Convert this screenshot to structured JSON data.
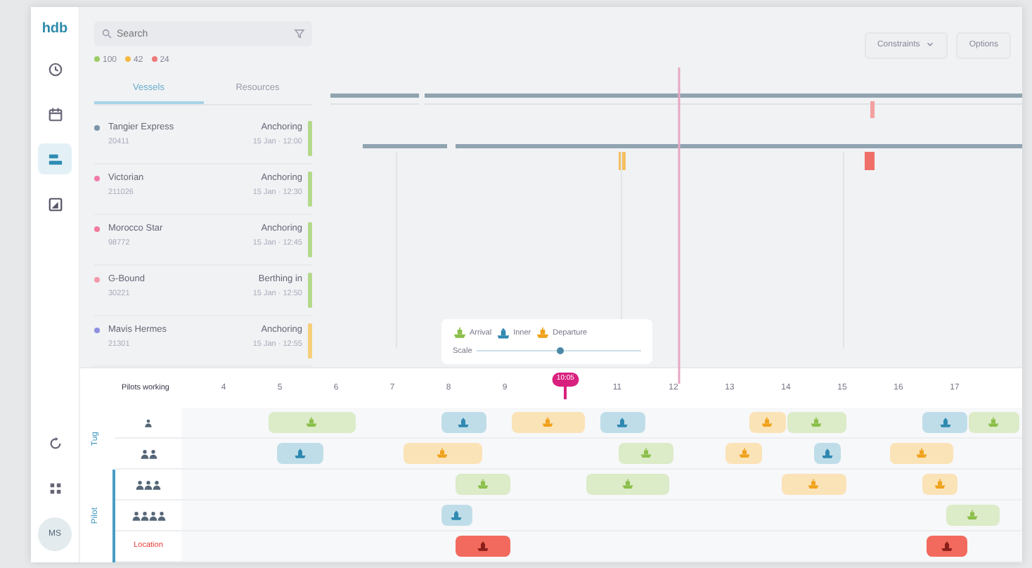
{
  "logo": "hdb",
  "nav": [
    {
      "selected": false
    },
    {
      "selected": false
    },
    {
      "selected": true
    },
    {
      "selected": false
    }
  ],
  "avatar": "MS",
  "search": {
    "placeholder": "Search"
  },
  "counts": [
    {
      "value": "100",
      "color": "#9ccc65"
    },
    {
      "value": "42",
      "color": "#f5b942"
    },
    {
      "value": "24",
      "color": "#ef7a7a"
    }
  ],
  "tabs": [
    {
      "label": "Vessels",
      "selected": true
    },
    {
      "label": "Resources",
      "selected": false
    }
  ],
  "vessels": [
    {
      "name": "Tangier Express",
      "code": "20411",
      "status": "Anchoring",
      "time": "15 Jan · 12:00",
      "color": "#7d93a8",
      "kind": "ready"
    },
    {
      "name": "Victorian",
      "code": "211026",
      "status": "Anchoring",
      "time": "15 Jan · 12:30",
      "color": "#f07aa8",
      "kind": "ready"
    },
    {
      "name": "Morocco Star",
      "code": "98772",
      "status": "Anchoring",
      "time": "15 Jan · 12:45",
      "color": "#f07a9a",
      "kind": "ready"
    },
    {
      "name": "G-Bound",
      "code": "30221",
      "status": "Berthing in",
      "time": "15 Jan · 12:50",
      "color": "#f49aaa",
      "kind": "ready"
    },
    {
      "name": "Mavis Hermes",
      "code": "21301",
      "status": "Anchoring",
      "time": "15 Jan · 12:55",
      "color": "#8f8fe0",
      "kind": "waiting"
    }
  ],
  "toolbar": [
    {
      "label": "Constraints",
      "dropdown": true
    },
    {
      "label": "Options",
      "dropdown": false
    }
  ],
  "legend": {
    "items": [
      {
        "kind": "arrival",
        "label": "Arrival"
      },
      {
        "kind": "inner",
        "label": "Inner"
      },
      {
        "kind": "departure",
        "label": "Departure"
      }
    ],
    "scale_label": "Scale",
    "level": 0.5
  },
  "timeline": {
    "header": "Pilots working",
    "now": "10:05",
    "ticks": [
      "4",
      "5",
      "6",
      "7",
      "8",
      "9",
      "11",
      "12",
      "13",
      "14",
      "15",
      "16",
      "17"
    ],
    "groups": [
      {
        "label": "Tug",
        "rows": [
          {
            "kind": "single",
            "events": [
              {
                "kind": "arrival"
              },
              {
                "kind": "inner"
              },
              {
                "kind": "departure"
              },
              {
                "kind": "inner"
              },
              {
                "kind": "departure"
              },
              {
                "kind": "arrival"
              },
              {
                "kind": "inner"
              },
              {
                "kind": "arrival"
              }
            ]
          },
          {
            "kind": "pair",
            "events": [
              {
                "kind": "inner"
              },
              {
                "kind": "departure"
              },
              {
                "kind": "arrival"
              },
              {
                "kind": "departure"
              },
              {
                "kind": "inner"
              },
              {
                "kind": "departure"
              }
            ]
          }
        ]
      },
      {
        "label": "Pilot",
        "rows": [
          {
            "kind": "trio",
            "events": [
              {
                "kind": "arrival"
              },
              {
                "kind": "arrival"
              },
              {
                "kind": "departure"
              },
              {
                "kind": "departure"
              }
            ]
          },
          {
            "kind": "quad",
            "events": [
              {
                "kind": "inner"
              },
              {
                "kind": "arrival"
              }
            ]
          },
          {
            "kind": "label",
            "label": "Location",
            "alert": true,
            "events": [
              {
                "kind": "alert"
              },
              {
                "kind": "alert"
              }
            ]
          }
        ]
      }
    ]
  }
}
